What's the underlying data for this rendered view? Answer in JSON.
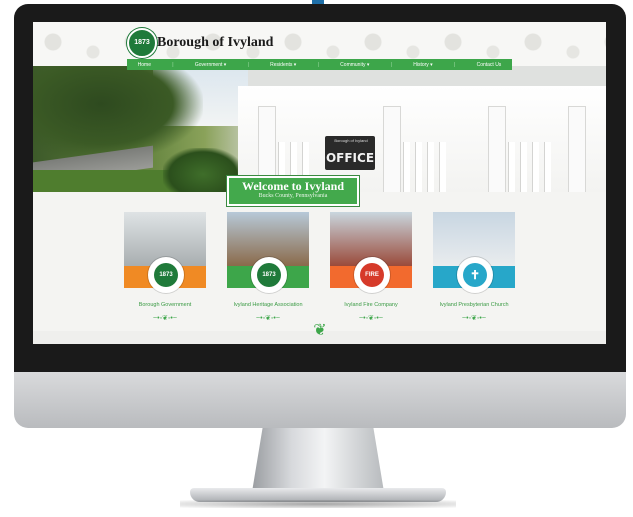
{
  "site": {
    "title": "Borough of Ivyland",
    "logo_text": "1873"
  },
  "nav": {
    "items": [
      "Home",
      "Government ▾",
      "Residents ▾",
      "Community ▾",
      "History ▾",
      "Contact Us"
    ]
  },
  "hero": {
    "sign_small": "Borough of Ivyland",
    "sign_text": "OFFICE",
    "welcome_title": "Welcome to Ivyland",
    "welcome_subtitle": "Bucks County, Pennsylvania"
  },
  "cards": [
    {
      "label": "Borough Government",
      "band_color": "#f08a24",
      "seal_text": "1873"
    },
    {
      "label": "Ivyland Heritage Association",
      "band_color": "#3da64a",
      "seal_text": "1873"
    },
    {
      "label": "Ivyland Fire Company",
      "band_color": "#f26a2e",
      "seal_text": "FIRE"
    },
    {
      "label": "Ivyland Presbyterian Church",
      "band_color": "#27a7c9",
      "seal_text": "✝"
    }
  ],
  "colors": {
    "accent_green": "#3da64a",
    "bezel": "#1a1a1a"
  }
}
